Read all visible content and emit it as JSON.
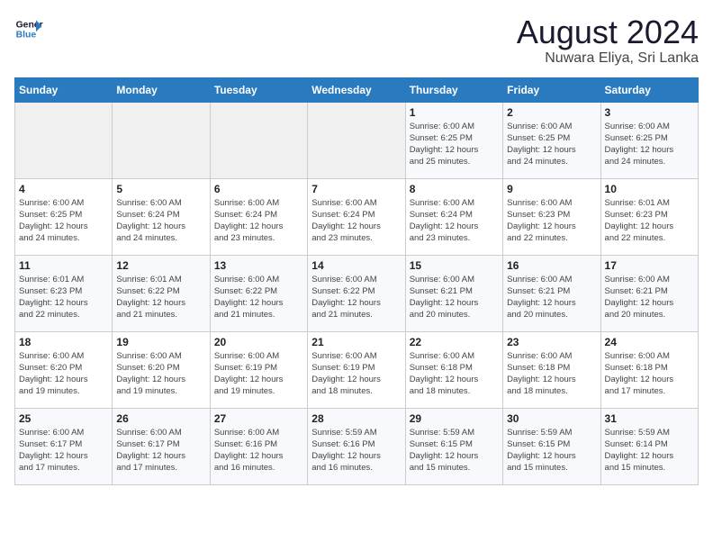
{
  "header": {
    "logo_line1": "General",
    "logo_line2": "Blue",
    "month_year": "August 2024",
    "location": "Nuwara Eliya, Sri Lanka"
  },
  "weekdays": [
    "Sunday",
    "Monday",
    "Tuesday",
    "Wednesday",
    "Thursday",
    "Friday",
    "Saturday"
  ],
  "weeks": [
    [
      {
        "day": "",
        "info": ""
      },
      {
        "day": "",
        "info": ""
      },
      {
        "day": "",
        "info": ""
      },
      {
        "day": "",
        "info": ""
      },
      {
        "day": "1",
        "info": "Sunrise: 6:00 AM\nSunset: 6:25 PM\nDaylight: 12 hours\nand 25 minutes."
      },
      {
        "day": "2",
        "info": "Sunrise: 6:00 AM\nSunset: 6:25 PM\nDaylight: 12 hours\nand 24 minutes."
      },
      {
        "day": "3",
        "info": "Sunrise: 6:00 AM\nSunset: 6:25 PM\nDaylight: 12 hours\nand 24 minutes."
      }
    ],
    [
      {
        "day": "4",
        "info": "Sunrise: 6:00 AM\nSunset: 6:25 PM\nDaylight: 12 hours\nand 24 minutes."
      },
      {
        "day": "5",
        "info": "Sunrise: 6:00 AM\nSunset: 6:24 PM\nDaylight: 12 hours\nand 24 minutes."
      },
      {
        "day": "6",
        "info": "Sunrise: 6:00 AM\nSunset: 6:24 PM\nDaylight: 12 hours\nand 23 minutes."
      },
      {
        "day": "7",
        "info": "Sunrise: 6:00 AM\nSunset: 6:24 PM\nDaylight: 12 hours\nand 23 minutes."
      },
      {
        "day": "8",
        "info": "Sunrise: 6:00 AM\nSunset: 6:24 PM\nDaylight: 12 hours\nand 23 minutes."
      },
      {
        "day": "9",
        "info": "Sunrise: 6:00 AM\nSunset: 6:23 PM\nDaylight: 12 hours\nand 22 minutes."
      },
      {
        "day": "10",
        "info": "Sunrise: 6:01 AM\nSunset: 6:23 PM\nDaylight: 12 hours\nand 22 minutes."
      }
    ],
    [
      {
        "day": "11",
        "info": "Sunrise: 6:01 AM\nSunset: 6:23 PM\nDaylight: 12 hours\nand 22 minutes."
      },
      {
        "day": "12",
        "info": "Sunrise: 6:01 AM\nSunset: 6:22 PM\nDaylight: 12 hours\nand 21 minutes."
      },
      {
        "day": "13",
        "info": "Sunrise: 6:00 AM\nSunset: 6:22 PM\nDaylight: 12 hours\nand 21 minutes."
      },
      {
        "day": "14",
        "info": "Sunrise: 6:00 AM\nSunset: 6:22 PM\nDaylight: 12 hours\nand 21 minutes."
      },
      {
        "day": "15",
        "info": "Sunrise: 6:00 AM\nSunset: 6:21 PM\nDaylight: 12 hours\nand 20 minutes."
      },
      {
        "day": "16",
        "info": "Sunrise: 6:00 AM\nSunset: 6:21 PM\nDaylight: 12 hours\nand 20 minutes."
      },
      {
        "day": "17",
        "info": "Sunrise: 6:00 AM\nSunset: 6:21 PM\nDaylight: 12 hours\nand 20 minutes."
      }
    ],
    [
      {
        "day": "18",
        "info": "Sunrise: 6:00 AM\nSunset: 6:20 PM\nDaylight: 12 hours\nand 19 minutes."
      },
      {
        "day": "19",
        "info": "Sunrise: 6:00 AM\nSunset: 6:20 PM\nDaylight: 12 hours\nand 19 minutes."
      },
      {
        "day": "20",
        "info": "Sunrise: 6:00 AM\nSunset: 6:19 PM\nDaylight: 12 hours\nand 19 minutes."
      },
      {
        "day": "21",
        "info": "Sunrise: 6:00 AM\nSunset: 6:19 PM\nDaylight: 12 hours\nand 18 minutes."
      },
      {
        "day": "22",
        "info": "Sunrise: 6:00 AM\nSunset: 6:18 PM\nDaylight: 12 hours\nand 18 minutes."
      },
      {
        "day": "23",
        "info": "Sunrise: 6:00 AM\nSunset: 6:18 PM\nDaylight: 12 hours\nand 18 minutes."
      },
      {
        "day": "24",
        "info": "Sunrise: 6:00 AM\nSunset: 6:18 PM\nDaylight: 12 hours\nand 17 minutes."
      }
    ],
    [
      {
        "day": "25",
        "info": "Sunrise: 6:00 AM\nSunset: 6:17 PM\nDaylight: 12 hours\nand 17 minutes."
      },
      {
        "day": "26",
        "info": "Sunrise: 6:00 AM\nSunset: 6:17 PM\nDaylight: 12 hours\nand 17 minutes."
      },
      {
        "day": "27",
        "info": "Sunrise: 6:00 AM\nSunset: 6:16 PM\nDaylight: 12 hours\nand 16 minutes."
      },
      {
        "day": "28",
        "info": "Sunrise: 5:59 AM\nSunset: 6:16 PM\nDaylight: 12 hours\nand 16 minutes."
      },
      {
        "day": "29",
        "info": "Sunrise: 5:59 AM\nSunset: 6:15 PM\nDaylight: 12 hours\nand 15 minutes."
      },
      {
        "day": "30",
        "info": "Sunrise: 5:59 AM\nSunset: 6:15 PM\nDaylight: 12 hours\nand 15 minutes."
      },
      {
        "day": "31",
        "info": "Sunrise: 5:59 AM\nSunset: 6:14 PM\nDaylight: 12 hours\nand 15 minutes."
      }
    ]
  ]
}
